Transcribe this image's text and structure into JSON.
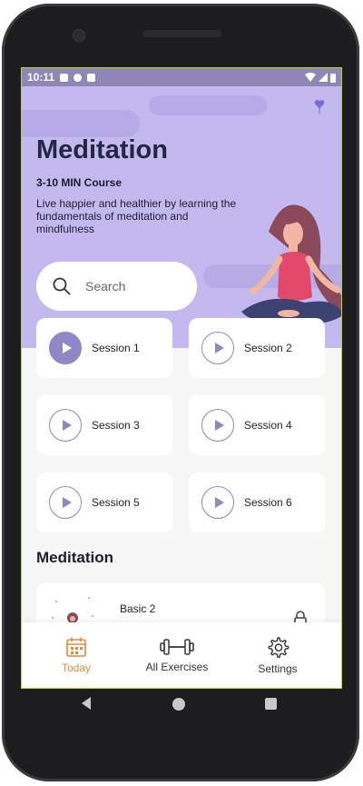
{
  "status_bar": {
    "time": "10:11"
  },
  "header": {
    "title": "Meditation",
    "subtitle": "3-10 MIN Course",
    "description": "Live happier and healthier by learning the fundamentals of meditation and mindfulness"
  },
  "search": {
    "placeholder": "Search"
  },
  "sessions": [
    {
      "label": "Session 1",
      "active": true
    },
    {
      "label": "Session 2",
      "active": false
    },
    {
      "label": "Session 3",
      "active": false
    },
    {
      "label": "Session 4",
      "active": false
    },
    {
      "label": "Session 5",
      "active": false
    },
    {
      "label": "Session 6",
      "active": false
    }
  ],
  "section": {
    "title": "Meditation"
  },
  "card": {
    "title": "Basic 2",
    "icon": "lock-icon"
  },
  "bottom_nav": [
    {
      "label": "Today",
      "icon": "calendar-icon",
      "active": true
    },
    {
      "label": "All Exercises",
      "icon": "dumbbell-icon",
      "active": false
    },
    {
      "label": "Settings",
      "icon": "gear-icon",
      "active": false
    }
  ],
  "colors": {
    "hero_background": "#c3b9ef",
    "accent": "#8f86c6",
    "active_nav": "#e0883a",
    "title": "#232645"
  }
}
